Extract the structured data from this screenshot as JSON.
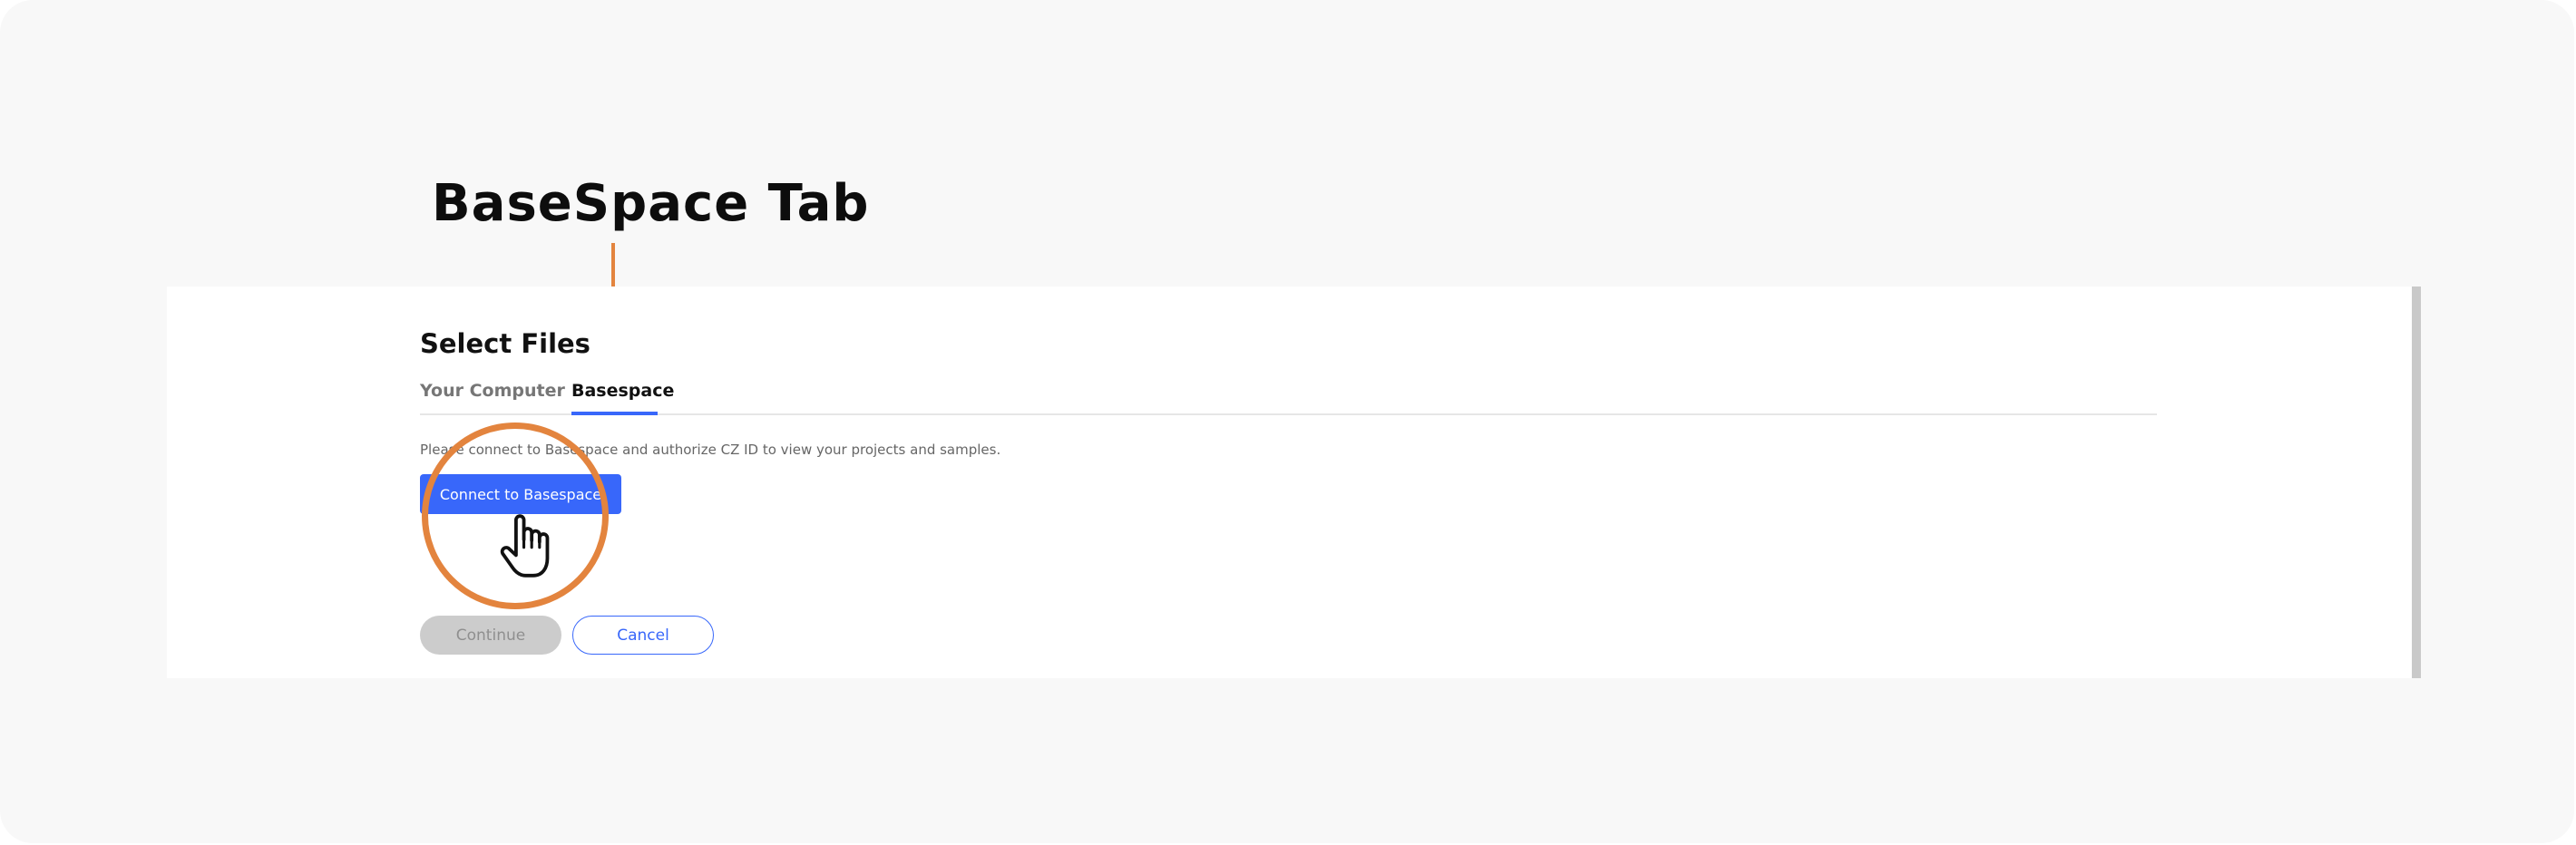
{
  "callout": {
    "title": "BaseSpace Tab"
  },
  "dialog": {
    "title": "Select Files",
    "tabs": [
      {
        "label": "Your Computer",
        "active": false
      },
      {
        "label": "Basespace",
        "active": true
      }
    ],
    "description": "Please connect to Basespace and authorize CZ ID to view your projects and samples.",
    "connect_label": "Connect to Basespace",
    "continue_label": "Continue",
    "cancel_label": "Cancel"
  },
  "colors": {
    "accent": "#3867fa",
    "callout": "#e3843e",
    "disabled_bg": "#cccccc",
    "background": "#f8f8f8"
  },
  "icons": {
    "cursor": "hand-pointer-icon"
  }
}
